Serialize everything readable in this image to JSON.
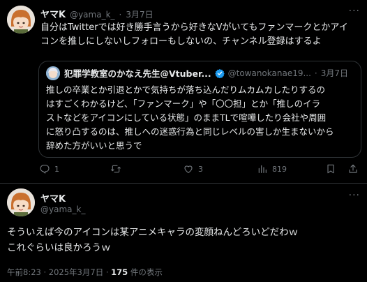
{
  "tweet": {
    "display_name": "ヤマK",
    "handle": "@yama_k_",
    "dot": "·",
    "date": "3月7日",
    "more": "···",
    "text_line1": "自分はTwitterでは好き勝手言うから好きなVがいてもファンマークとかアイ",
    "text_line2": "コンを推しにしないしフォローもしないの、チャンネル登録はするよ"
  },
  "quote": {
    "display_name": "犯罪学教室のかなえ先生@Vtuber...",
    "handle": "@towanokanae19...",
    "dot": "·",
    "date": "3月7日",
    "line1": "推しの卒業とか引退とかで気持ちが落ち込んだりムカムカしたりするの",
    "line2": "はすごくわかるけど、「ファンマーク」や「〇〇担」とか「推しのイラ",
    "line3": "ストなどをアイコンにしている状態」のままTLで喧嘩したり会社や周囲",
    "line4": "に怒り凸するのは、推しへの迷惑行為と同じレベルの害しか生まないから",
    "line5": "辞めた方がいいと思うで"
  },
  "actions": {
    "replies": "1",
    "retweets": "",
    "likes": "3",
    "views": "819"
  },
  "reply": {
    "display_name": "ヤマK",
    "handle": "@yama_k_",
    "more": "···",
    "text_line1": "そういえば今のアイコンは某アニメキャラの変顔ねんどろいどだわｗ",
    "text_line2": "これぐらいは良かろうｗ",
    "time": "午前8:23 · 2025年3月7日 · ",
    "view_count": "175",
    "view_suffix": " 件の表示"
  },
  "colors": {
    "background": "#000000",
    "text": "#e7e9ea",
    "muted": "#71767b",
    "border": "#2f3336",
    "verified": "#1d9bf0"
  },
  "icons": [
    "avatar",
    "verified-badge-icon",
    "reply-icon",
    "retweet-icon",
    "like-icon",
    "views-icon",
    "bookmark-icon",
    "share-icon",
    "more-icon"
  ]
}
